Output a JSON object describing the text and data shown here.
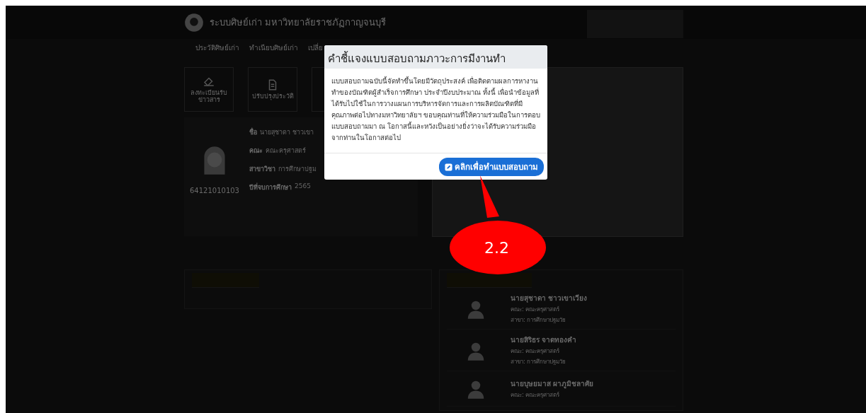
{
  "header": {
    "title": "ระบบศิษย์เก่า มหาวิทยาลัยราชภัฏกาญจนบุรี"
  },
  "nav": [
    {
      "label": "ประวัติศิษย์เก่า"
    },
    {
      "label": "ทำเนียบศิษย์เก่า"
    },
    {
      "label": "เปลี่ย"
    }
  ],
  "cards": [
    {
      "label": "ลงทะเบียนรับข่าวสาร"
    },
    {
      "label": "ปรับปรุงประวัติ"
    }
  ],
  "profile": {
    "student_id": "64121010103",
    "fields": [
      {
        "label": "ชื่อ",
        "value": "นายสุชาดา ชาวเขา"
      },
      {
        "label": "คณะ",
        "value": "คณะครุศาสตร์"
      },
      {
        "label": "สาขาวิชา",
        "value": "การศึกษาปฐม"
      },
      {
        "label": "ปีที่จบการศึกษา",
        "value": "2565"
      }
    ]
  },
  "alumni": [
    {
      "name": "นายสุชาดา ชาวเขาเวียง",
      "faculty": "คณะ: คณะครุศาสตร์",
      "major": "สาขา: การศึกษาปฐมวัย"
    },
    {
      "name": "นายสิริธร จาดทองคำ",
      "faculty": "คณะ: คณะครุศาสตร์",
      "major": "สาขา: การศึกษาปฐมวัย"
    },
    {
      "name": "นายบุษยมาส ผาภูมิชลาศัย",
      "faculty": "คณะ: คณะครุศาสตร์"
    }
  ],
  "modal": {
    "title": "คำชี้แจงแบบสอบถามภาวะการมีงานทำ",
    "body": "แบบสอบถามฉบับนี้จัดทำขึ้นโดยมีวัตถุประสงค์ เพื่อติดตามผลการหางานทำของบัณฑิตผู้สำเร็จการศึกษา ประจำปีงบประมาณ ทั้งนี้ เพื่อนำข้อมูลที่ได้รับไปใช้ในการวางแผนการบริหารจัดการและการผลิตบัณฑิตที่มีคุณภาพต่อไปทางมหาวิทยาลัยฯ ขอบคุณท่านที่ให้ความร่วมมือในการตอบแบบสอบถามมา ณ โอกาสนี้และหวังเป็นอย่างยิ่งว่าจะได้รับความร่วมมือจากท่านในโอกาสต่อไป",
    "button": "คลิกเพื่อทำแบบสอบถาม"
  },
  "annotation": {
    "label": "2.2"
  }
}
